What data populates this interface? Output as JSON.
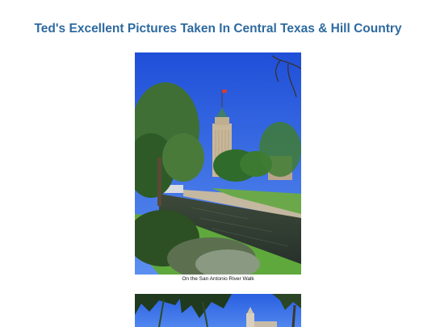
{
  "page": {
    "title": "Ted's Excellent Pictures Taken In Central Texas & Hill Country",
    "title_color": "#2e6aa0"
  },
  "photos": [
    {
      "caption": "On the San Antonio River Walk",
      "depicts": "photo-riverwalk-tower"
    },
    {
      "caption": "",
      "depicts": "photo-palm-trees-tower"
    }
  ]
}
